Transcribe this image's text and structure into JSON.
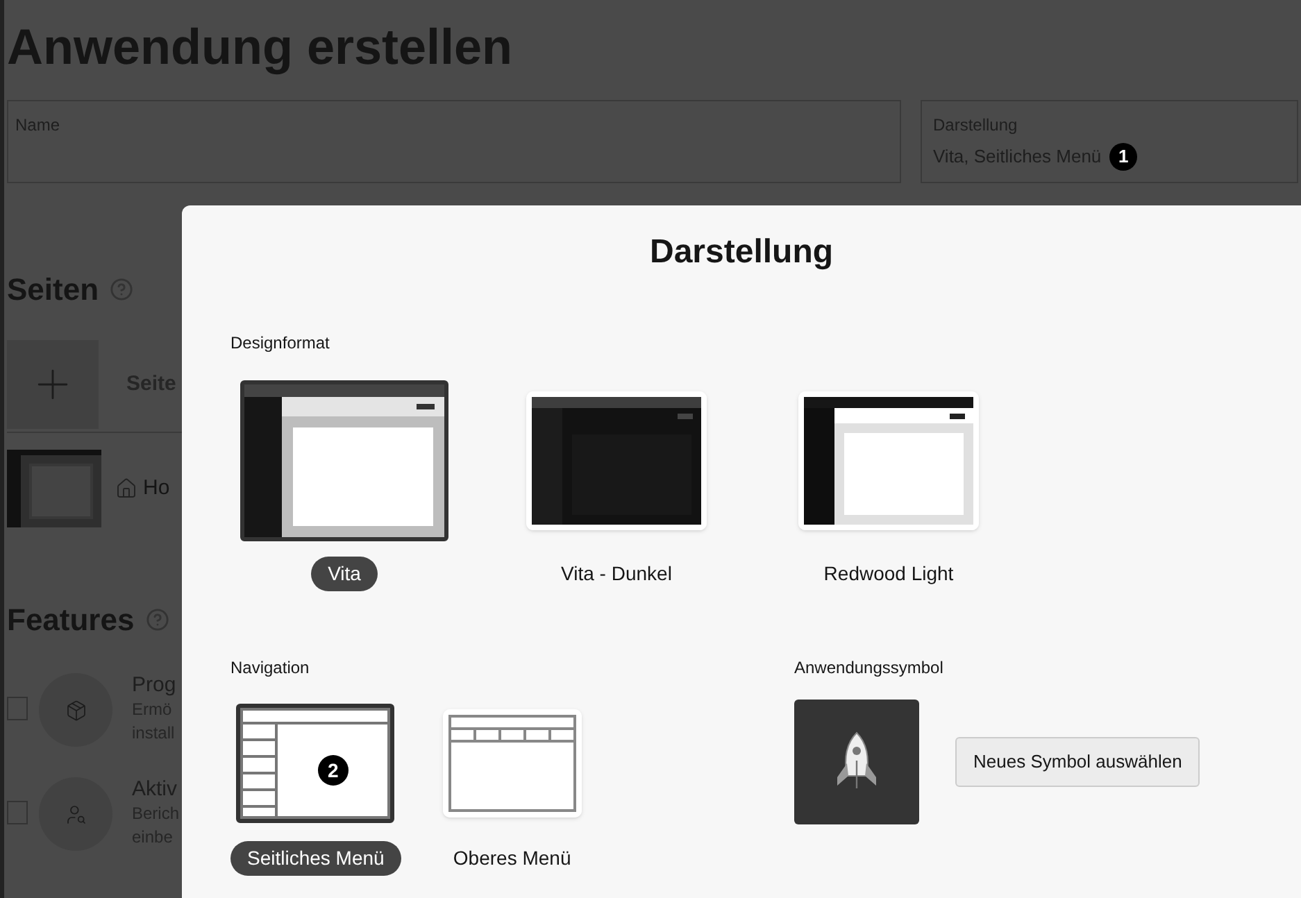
{
  "page": {
    "title": "Anwendung erstellen",
    "name_field": {
      "label": "Name"
    },
    "appearance_field": {
      "label": "Darstellung",
      "value": "Vita, Seitliches Menü",
      "callout": "1"
    },
    "pages_section": {
      "title": "Seiten",
      "add_label": "Seite",
      "home_label": "Ho"
    },
    "features_section": {
      "title": "Features",
      "items": [
        {
          "kind": "package",
          "title": "Prog",
          "lines": [
            "Ermö",
            "install"
          ],
          "checked": false
        },
        {
          "kind": "activity",
          "title": "Aktiv",
          "lines": [
            "Berich",
            "einbe"
          ],
          "checked": false
        }
      ]
    }
  },
  "dialog": {
    "title": "Darstellung",
    "design_label": "Designformat",
    "designs": [
      {
        "kind": "vita",
        "label": "Vita",
        "selected": true
      },
      {
        "kind": "dark",
        "label": "Vita - Dunkel",
        "selected": false
      },
      {
        "kind": "redwood",
        "label": "Redwood Light",
        "selected": false
      }
    ],
    "navigation_label": "Navigation",
    "navigation": [
      {
        "kind": "side",
        "label": "Seitliches Menü",
        "selected": true,
        "callout": "2"
      },
      {
        "kind": "top",
        "label": "Oberes Menü",
        "selected": false
      }
    ],
    "icon_label": "Anwendungssymbol",
    "icon_button": "Neues Symbol auswählen"
  }
}
